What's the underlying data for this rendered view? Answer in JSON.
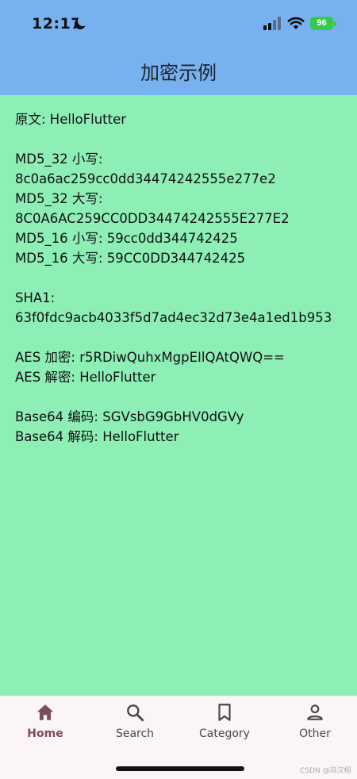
{
  "status_bar": {
    "time": "12:17",
    "battery": "96"
  },
  "app_bar": {
    "title": "加密示例"
  },
  "content": {
    "lines": [
      "原文: HelloFlutter",
      "",
      "MD5_32 小写:",
      "8c0a6ac259cc0dd34474242555e277e2",
      "MD5_32 大写:",
      "8C0A6AC259CC0DD34474242555E277E2",
      "MD5_16 小写: 59cc0dd344742425",
      "MD5_16 大写: 59CC0DD344742425",
      "",
      "SHA1:",
      "63f0fdc9acb4033f5d7ad4ec32d73e4a1ed1b953",
      "",
      "AES 加密: r5RDiwQuhxMgpEIlQAtQWQ==",
      "AES 解密: HelloFlutter",
      "",
      "Base64 编码: SGVsbG9GbHV0dGVy",
      "Base64 解码: HelloFlutter"
    ]
  },
  "bottom_nav": {
    "items": [
      {
        "label": "Home",
        "icon": "home-icon",
        "active": true
      },
      {
        "label": "Search",
        "icon": "search-icon",
        "active": false
      },
      {
        "label": "Category",
        "icon": "bookmark-icon",
        "active": false
      },
      {
        "label": "Other",
        "icon": "person-icon",
        "active": false
      }
    ]
  },
  "watermark": "CSDN @冯汉栩",
  "colors": {
    "app_bar_bg": "#78B1F0",
    "body_bg": "#8DEEB6",
    "nav_bg": "#FCF5F6",
    "nav_active": "#7B4D5E",
    "nav_inactive": "#49454F"
  }
}
